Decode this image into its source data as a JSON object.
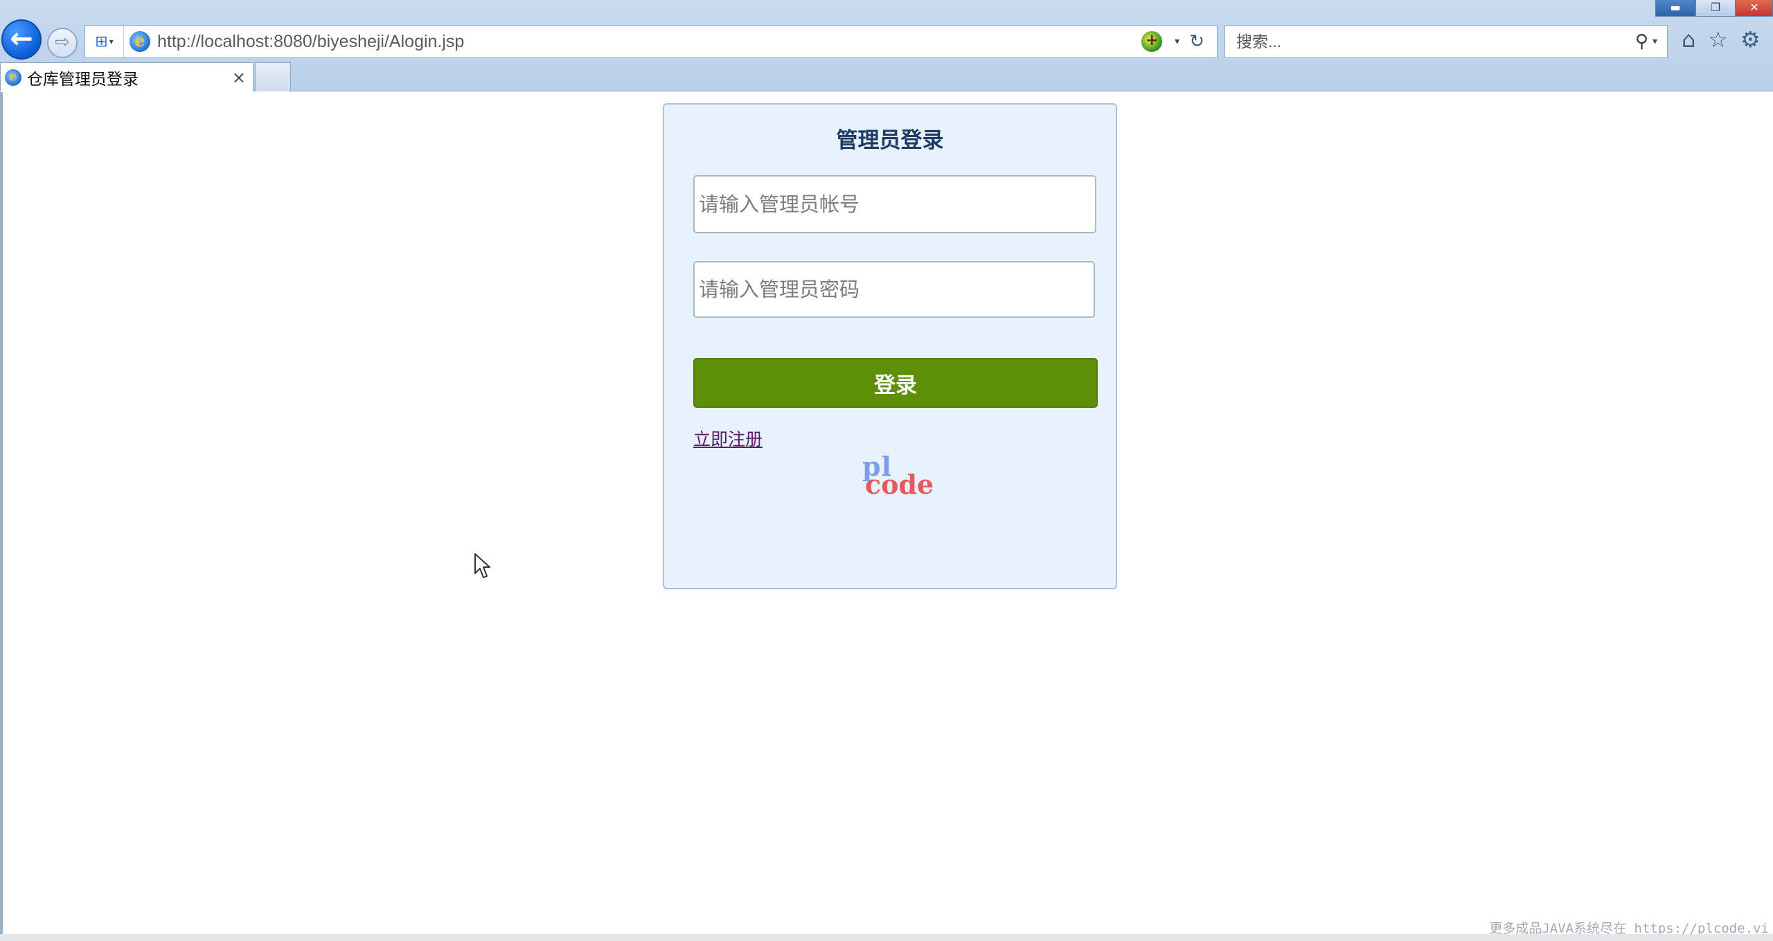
{
  "browser": {
    "url": "http://localhost:8080/biyesheji/Alogin.jsp",
    "search_placeholder": "搜索...",
    "tab_title": "仓库管理员登录",
    "tab_close": "×",
    "icons": {
      "back": "←",
      "forward": "⇨",
      "shield": "⊞",
      "ie": "e",
      "compat": "+",
      "dropdown": "▾",
      "refresh": "↻",
      "search": "⚲",
      "home": "⌂",
      "favorites": "☆",
      "settings": "⚙",
      "minimize": "▬",
      "restore": "❐",
      "close": "✕"
    }
  },
  "login": {
    "title": "管理员登录",
    "account_placeholder": "请输入管理员帐号",
    "password_placeholder": "请输入管理员密码",
    "button_label": "登录",
    "register_link": "立即注册"
  },
  "watermark": {
    "logo_top": "pl",
    "logo_bottom": "code",
    "footer_text": "更多成品JAVA系统尽在 https://plcode.vi"
  },
  "colors": {
    "button": "#5e8f08",
    "panel": "#e8f2fd",
    "link": "#5e1a6e"
  }
}
